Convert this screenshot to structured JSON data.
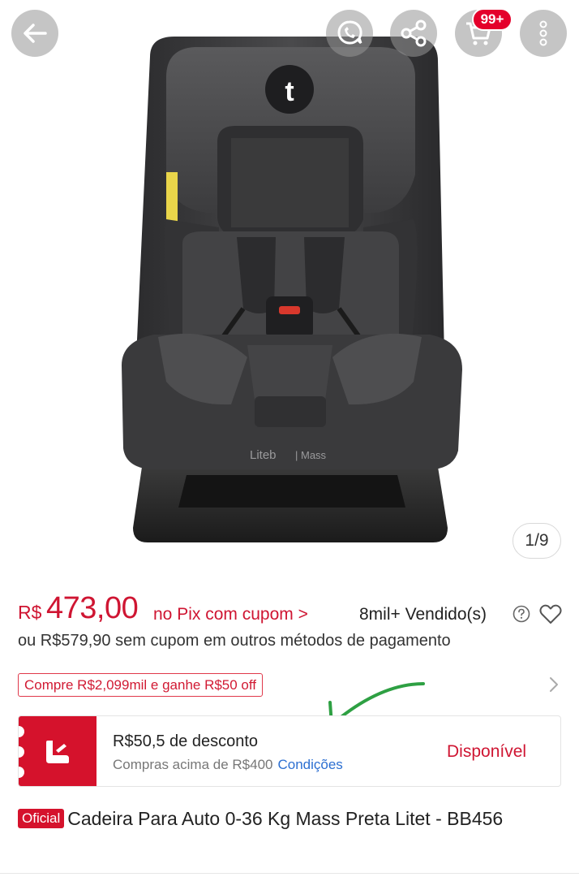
{
  "gallery": {
    "counter": "1/9",
    "seat_brand": "Liteb",
    "seat_model": "Mass",
    "cart_badge": "99+"
  },
  "price": {
    "currency": "R$",
    "value": "473,00",
    "pix_label": "no Pix com cupom >",
    "sold": "8mil+ Vendido(s)",
    "alt_price": "ou R$579,90 sem cupom em outros métodos de pagamento"
  },
  "promo": {
    "tag": "Compre R$2,099mil e ganhe R$50 off"
  },
  "coupon": {
    "title": "R$50,5 de desconto",
    "subtitle": "Compras acima de R$400",
    "conditions_link": "Condições",
    "status": "Disponível"
  },
  "product": {
    "badge": "Oficial",
    "title": "Cadeira Para Auto 0-36 Kg Mass Preta Litet - BB456"
  },
  "colors": {
    "price_red": "#cf1532",
    "badge_red": "#d5122c",
    "link_blue": "#2c6fd1",
    "annotation_green": "#2ea043"
  },
  "icons": [
    "back-arrow-icon",
    "whatsapp-icon",
    "share-icon",
    "cart-icon",
    "more-vertical-icon",
    "help-circle-icon",
    "heart-icon",
    "chevron-right-icon",
    "car-seat-icon"
  ]
}
